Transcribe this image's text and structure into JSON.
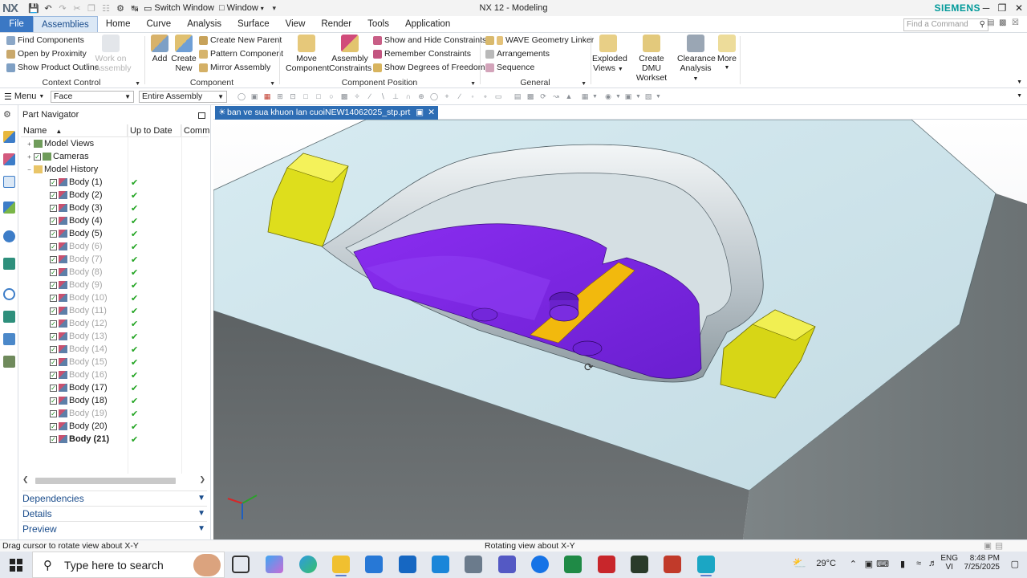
{
  "titlebar": {
    "logo": "NX",
    "switch_window": "Switch Window",
    "window_menu": "Window",
    "title": "NX 12 - Modeling",
    "brand": "SIEMENS",
    "minimize": "─",
    "restore": "❐",
    "close": "✕"
  },
  "tabs": [
    {
      "label": "File"
    },
    {
      "label": "Assemblies"
    },
    {
      "label": "Home"
    },
    {
      "label": "Curve"
    },
    {
      "label": "Analysis"
    },
    {
      "label": "Surface"
    },
    {
      "label": "View"
    },
    {
      "label": "Render"
    },
    {
      "label": "Tools"
    },
    {
      "label": "Application"
    }
  ],
  "command_finder": {
    "placeholder": "Find a Command"
  },
  "ribbon": {
    "context_control": {
      "label": "Context Control",
      "find_components": "Find Components",
      "open_by_proximity": "Open by Proximity",
      "show_product_outline": "Show Product Outline",
      "work_on_assembly_1": "Work on",
      "work_on_assembly_2": "Assembly"
    },
    "component": {
      "label": "Component",
      "add": "Add",
      "create_new_1": "Create",
      "create_new_2": "New",
      "create_new_parent": "Create New Parent",
      "pattern_component": "Pattern Component",
      "mirror_assembly": "Mirror Assembly"
    },
    "component_position": {
      "label": "Component Position",
      "move_component_1": "Move",
      "move_component_2": "Component",
      "assembly_constraints_1": "Assembly",
      "assembly_constraints_2": "Constraints",
      "show_hide_constraints": "Show and Hide Constraints",
      "remember_constraints": "Remember Constraints",
      "show_degrees_of_freedom": "Show Degrees of Freedom"
    },
    "general": {
      "label": "General",
      "wave_geometry_linker": "WAVE Geometry Linker",
      "arrangements": "Arrangements",
      "sequence": "Sequence"
    },
    "exploded_views_1": "Exploded",
    "exploded_views_2": "Views",
    "create_dmu_1": "Create DMU",
    "create_dmu_2": "Workset",
    "clearance_1": "Clearance",
    "clearance_2": "Analysis",
    "more": "More"
  },
  "selection_bar": {
    "menu": "Menu",
    "filter": "Face",
    "scope": "Entire Assembly"
  },
  "navigator": {
    "title": "Part Navigator",
    "columns": [
      "Name",
      "Up to Date",
      "Comm"
    ],
    "rows": [
      {
        "label": "Model Views",
        "indent": 0,
        "expand": "+",
        "check": false,
        "state": "normal",
        "uptodate": ""
      },
      {
        "label": "Cameras",
        "indent": 0,
        "expand": "+",
        "check": true,
        "state": "normal",
        "uptodate": ""
      },
      {
        "label": "Model History",
        "indent": 0,
        "expand": "−",
        "check": false,
        "state": "normal",
        "uptodate": ""
      },
      {
        "label": "Body (1)",
        "indent": 1,
        "expand": "",
        "check": true,
        "state": "normal",
        "uptodate": "✔"
      },
      {
        "label": "Body (2)",
        "indent": 1,
        "expand": "",
        "check": true,
        "state": "normal",
        "uptodate": "✔"
      },
      {
        "label": "Body (3)",
        "indent": 1,
        "expand": "",
        "check": true,
        "state": "normal",
        "uptodate": "✔"
      },
      {
        "label": "Body (4)",
        "indent": 1,
        "expand": "",
        "check": true,
        "state": "normal",
        "uptodate": "✔"
      },
      {
        "label": "Body (5)",
        "indent": 1,
        "expand": "",
        "check": true,
        "state": "normal",
        "uptodate": "✔"
      },
      {
        "label": "Body (6)",
        "indent": 1,
        "expand": "",
        "check": true,
        "state": "dim",
        "uptodate": "✔"
      },
      {
        "label": "Body (7)",
        "indent": 1,
        "expand": "",
        "check": true,
        "state": "dim",
        "uptodate": "✔"
      },
      {
        "label": "Body (8)",
        "indent": 1,
        "expand": "",
        "check": true,
        "state": "dim",
        "uptodate": "✔"
      },
      {
        "label": "Body (9)",
        "indent": 1,
        "expand": "",
        "check": true,
        "state": "dim",
        "uptodate": "✔"
      },
      {
        "label": "Body (10)",
        "indent": 1,
        "expand": "",
        "check": true,
        "state": "dim",
        "uptodate": "✔"
      },
      {
        "label": "Body (11)",
        "indent": 1,
        "expand": "",
        "check": true,
        "state": "dim",
        "uptodate": "✔"
      },
      {
        "label": "Body (12)",
        "indent": 1,
        "expand": "",
        "check": true,
        "state": "dim",
        "uptodate": "✔"
      },
      {
        "label": "Body (13)",
        "indent": 1,
        "expand": "",
        "check": true,
        "state": "dim",
        "uptodate": "✔"
      },
      {
        "label": "Body (14)",
        "indent": 1,
        "expand": "",
        "check": true,
        "state": "dim",
        "uptodate": "✔"
      },
      {
        "label": "Body (15)",
        "indent": 1,
        "expand": "",
        "check": true,
        "state": "dim",
        "uptodate": "✔"
      },
      {
        "label": "Body (16)",
        "indent": 1,
        "expand": "",
        "check": true,
        "state": "dim",
        "uptodate": "✔"
      },
      {
        "label": "Body (17)",
        "indent": 1,
        "expand": "",
        "check": true,
        "state": "normal",
        "uptodate": "✔"
      },
      {
        "label": "Body (18)",
        "indent": 1,
        "expand": "",
        "check": true,
        "state": "normal",
        "uptodate": "✔"
      },
      {
        "label": "Body (19)",
        "indent": 1,
        "expand": "",
        "check": true,
        "state": "dim",
        "uptodate": "✔"
      },
      {
        "label": "Body (20)",
        "indent": 1,
        "expand": "",
        "check": true,
        "state": "normal",
        "uptodate": "✔"
      },
      {
        "label": "Body (21)",
        "indent": 1,
        "expand": "",
        "check": true,
        "state": "bold",
        "uptodate": "✔"
      }
    ],
    "sections": {
      "dependencies": "Dependencies",
      "details": "Details",
      "preview": "Preview"
    }
  },
  "document": {
    "tab": "ban ve sua khuon lan cuoiNEW14062025_stp.prt"
  },
  "status": {
    "left": "Drag cursor to rotate view about X-Y",
    "center": "Rotating view about X-Y"
  },
  "taskbar": {
    "search_placeholder": "Type here to search",
    "weather": "29°C",
    "language_1": "ENG",
    "language_2": "VI",
    "time": "8:48 PM",
    "date": "7/25/2025"
  },
  "colors": {
    "accent": "#3b78c4",
    "doc_tab": "#2d6db4",
    "mold_base": "#cfe3ea",
    "cavity_purple": "#7a22e6",
    "insert_yellow": "#e8e61c",
    "gate_orange": "#f2b90d",
    "uptodate_green": "#1fa31f",
    "brand": "#009999"
  }
}
